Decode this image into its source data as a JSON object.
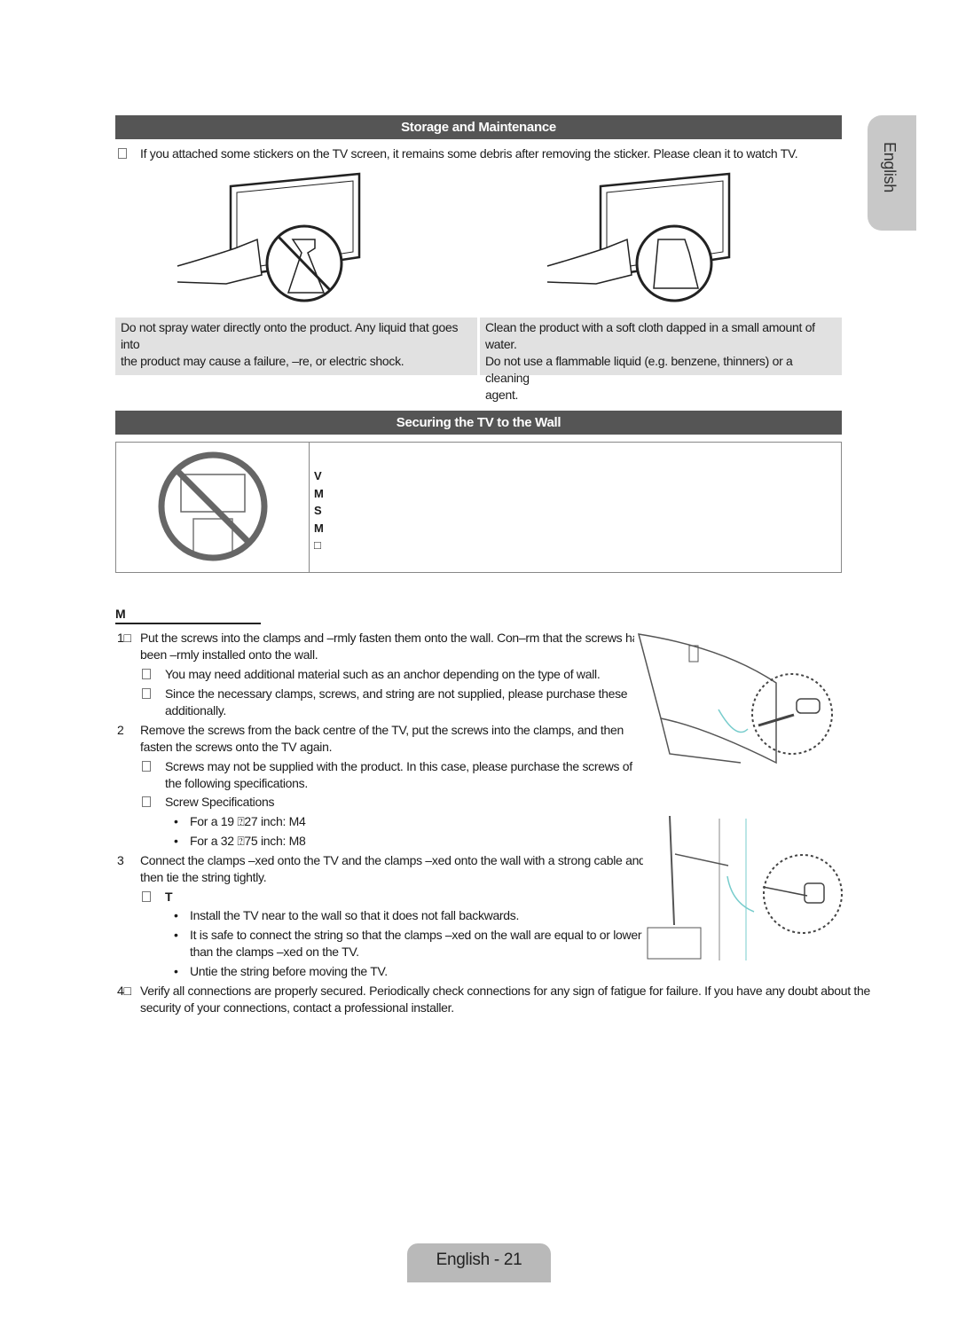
{
  "side_tab": "English",
  "storage": {
    "title": "Storage and Maintenance",
    "note": "If you attached some stickers on the TV screen, it remains some debris after removing the sticker. Please clean it to watch TV.",
    "caption_left": [
      "Do not spray water directly onto the product. Any liquid that goes into",
      "the product may cause a failure, –re, or electric shock."
    ],
    "caption_right": [
      "Clean the product with a soft cloth dapped in a small amount of water.",
      "Do not use a flammable liquid (e.g. benzene, thinners) or a cleaning",
      "agent."
    ]
  },
  "securing": {
    "title": "Securing the TV to the Wall",
    "box_glyphs": [
      "V",
      "M",
      "S",
      "M",
      "□"
    ],
    "subheading_glyph": "M",
    "steps": [
      {
        "num": "1□",
        "lines": [
          "Put the screws into the clamps and –rmly fasten them onto the wall. Con–rm that the screws have",
          "been –rmly installed onto the wall."
        ]
      },
      {
        "note": "You may need additional material such as an anchor depending on the type of wall."
      },
      {
        "note": "Since the necessary clamps, screws, and string are not supplied, please purchase these",
        "note2": "additionally."
      },
      {
        "num": "2",
        "lines": [
          "Remove the screws from the back centre of the TV, put the screws into the clamps, and then",
          "fasten the screws onto the TV again."
        ]
      },
      {
        "note": "Screws may not be supplied with the product. In this case, please purchase the screws of",
        "note2": "the following specifications."
      },
      {
        "note": "Screw Specifications"
      },
      {
        "bullet": "For a 19 ⍰27 inch: M4"
      },
      {
        "bullet": "For a 32 ⍰75 inch: M8"
      },
      {
        "num": "3",
        "lines": [
          "Connect the clamps –xed onto the TV and the clamps –xed onto the wall with a strong cable and",
          "then tie the string tightly."
        ]
      },
      {
        "note": "T"
      },
      {
        "bullet": "Install the TV near to the wall so that it does not fall backwards."
      },
      {
        "bullet": "It is safe to connect the string so that the clamps –xed on the wall are equal to or lower",
        "bullet2": "than the clamps –xed on the TV."
      },
      {
        "bullet": "Untie the string before moving the TV."
      },
      {
        "num": "4□",
        "lines": [
          "Verify all connections are properly secured. Periodically check connections for any sign of fatigue for failure. If you have any doubt about the",
          "security of your connections, contact a professional installer."
        ]
      }
    ]
  },
  "footer": "English - 21",
  "colors": {
    "header_bg": "#555555",
    "caption_bg": "#e1e1e1",
    "tab_bg": "#b9b9b9"
  }
}
